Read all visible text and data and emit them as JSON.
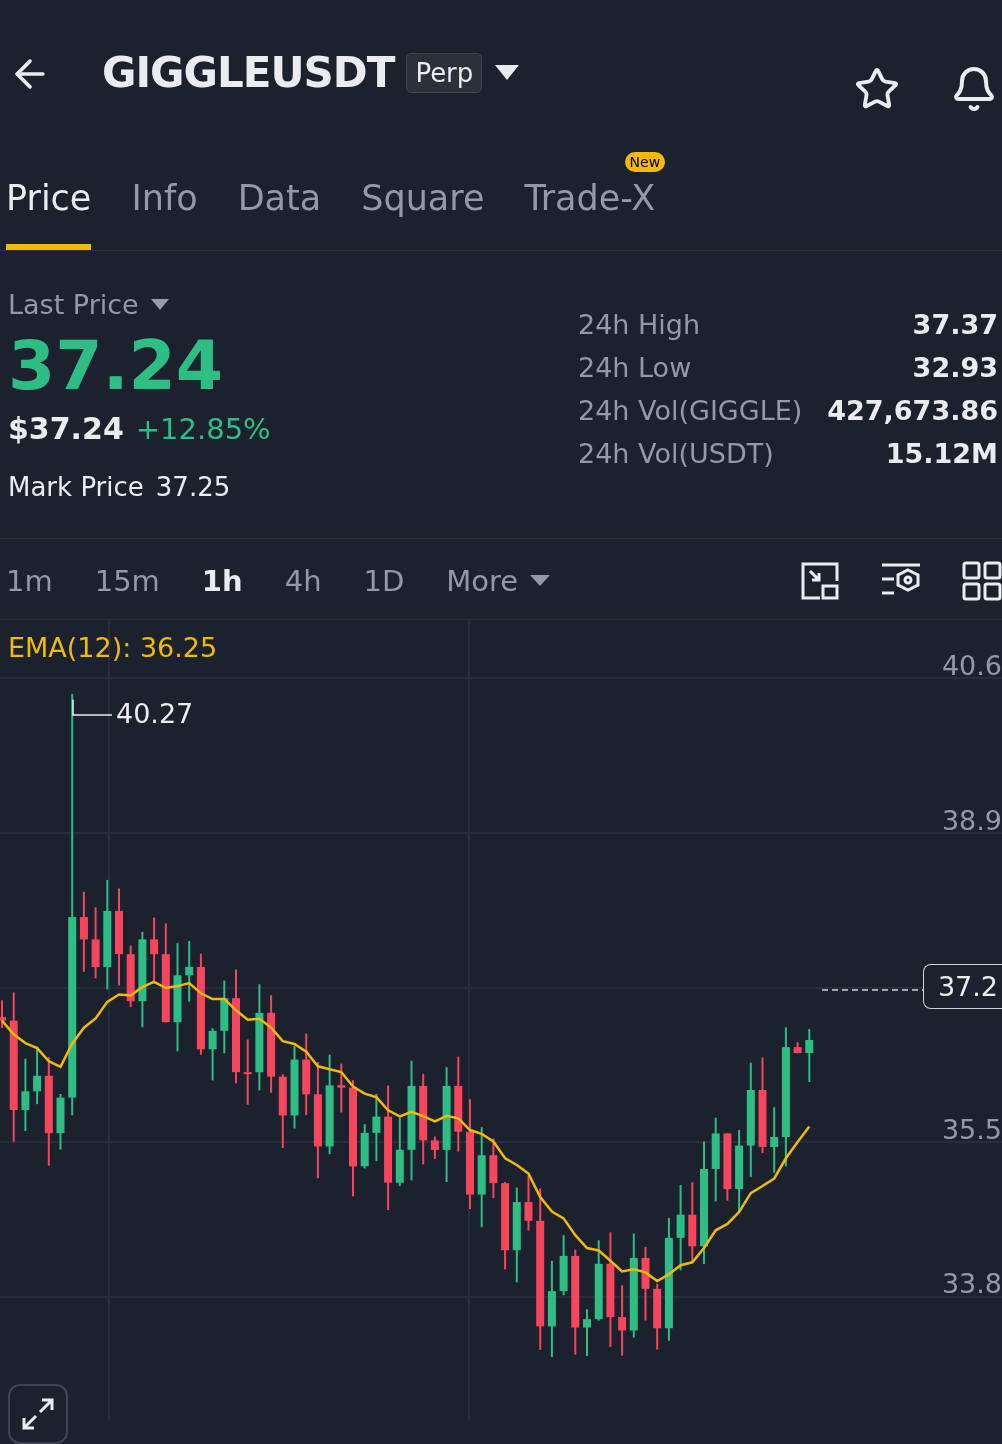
{
  "header": {
    "symbol": "GIGGLEUSDT",
    "badge": "Perp"
  },
  "tabs": [
    {
      "label": "Price",
      "selected": true
    },
    {
      "label": "Info",
      "selected": false
    },
    {
      "label": "Data",
      "selected": false
    },
    {
      "label": "Square",
      "selected": false
    },
    {
      "label": "Trade-X",
      "selected": false,
      "badge": "New"
    }
  ],
  "price": {
    "selector": "Last Price",
    "last": "37.24",
    "usd": "$37.24",
    "change": "+12.85%",
    "mark_label": "Mark Price",
    "mark_value": "37.25"
  },
  "stats": [
    {
      "label": "24h High",
      "value": "37.37"
    },
    {
      "label": "24h Low",
      "value": "32.93"
    },
    {
      "label": "24h Vol(GIGGLE)",
      "value": "427,673.86"
    },
    {
      "label": "24h Vol(USDT)",
      "value": "15.12M"
    }
  ],
  "intervals": [
    {
      "label": "1m",
      "selected": false
    },
    {
      "label": "15m",
      "selected": false
    },
    {
      "label": "1h",
      "selected": true
    },
    {
      "label": "4h",
      "selected": false
    },
    {
      "label": "1D",
      "selected": false
    }
  ],
  "more": "More",
  "chart": {
    "indicator": "EMA(12): 36.25",
    "high_label": "40.27",
    "y_axis": [
      "40.6",
      "38.9",
      "35.5",
      "33.8"
    ],
    "price_tag": "37.2"
  }
}
